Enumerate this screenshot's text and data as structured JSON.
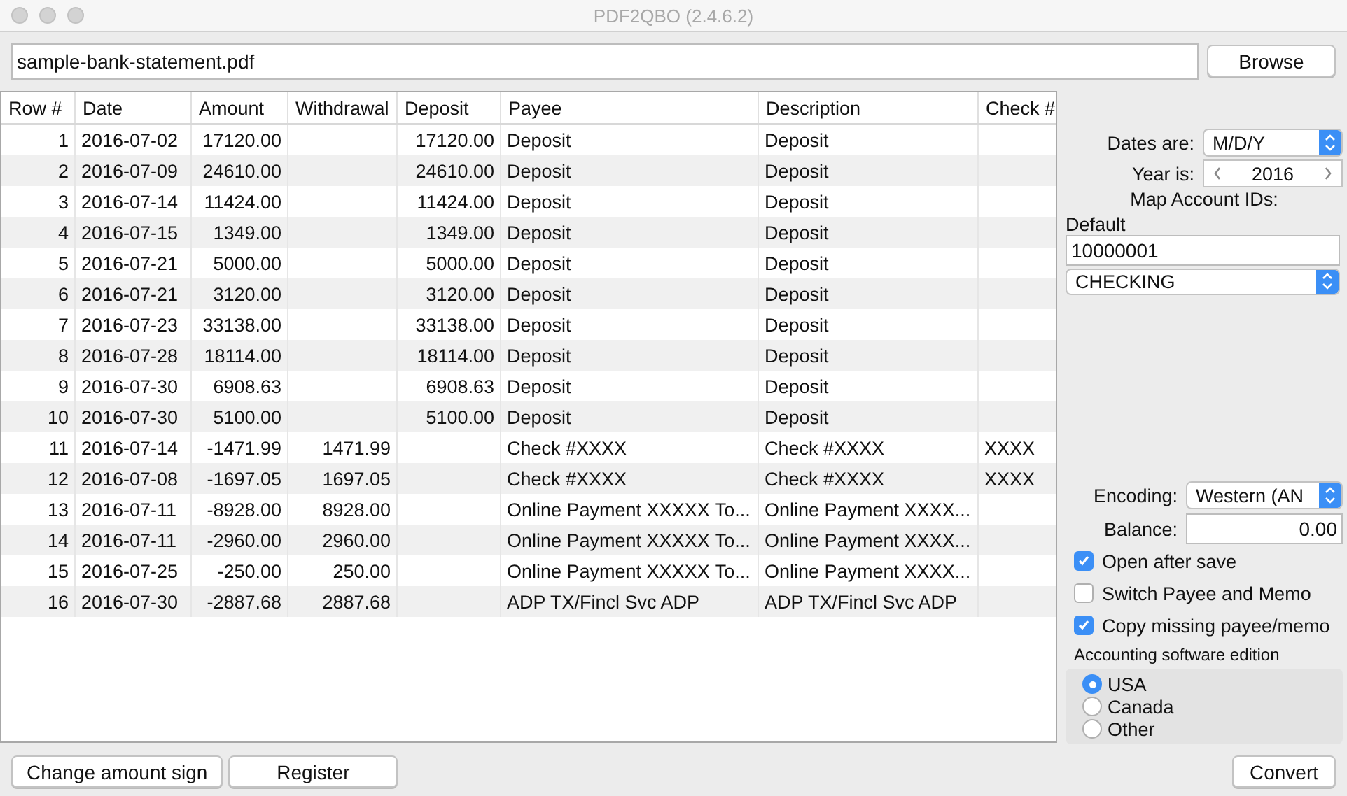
{
  "window": {
    "title": "PDF2QBO (2.4.6.2)"
  },
  "file_field": {
    "value": "sample-bank-statement.pdf"
  },
  "browse_button": "Browse",
  "table": {
    "columns": [
      "Row #",
      "Date",
      "Amount",
      "Withdrawal",
      "Deposit",
      "Payee",
      "Description",
      "Check #"
    ],
    "rows": [
      [
        "1",
        "2016-07-02",
        "17120.00",
        "",
        "17120.00",
        "Deposit",
        "Deposit",
        ""
      ],
      [
        "2",
        "2016-07-09",
        "24610.00",
        "",
        "24610.00",
        "Deposit",
        "Deposit",
        ""
      ],
      [
        "3",
        "2016-07-14",
        "11424.00",
        "",
        "11424.00",
        "Deposit",
        "Deposit",
        ""
      ],
      [
        "4",
        "2016-07-15",
        "1349.00",
        "",
        "1349.00",
        "Deposit",
        "Deposit",
        ""
      ],
      [
        "5",
        "2016-07-21",
        "5000.00",
        "",
        "5000.00",
        "Deposit",
        "Deposit",
        ""
      ],
      [
        "6",
        "2016-07-21",
        "3120.00",
        "",
        "3120.00",
        "Deposit",
        "Deposit",
        ""
      ],
      [
        "7",
        "2016-07-23",
        "33138.00",
        "",
        "33138.00",
        "Deposit",
        "Deposit",
        ""
      ],
      [
        "8",
        "2016-07-28",
        "18114.00",
        "",
        "18114.00",
        "Deposit",
        "Deposit",
        ""
      ],
      [
        "9",
        "2016-07-30",
        "6908.63",
        "",
        "6908.63",
        "Deposit",
        "Deposit",
        ""
      ],
      [
        "10",
        "2016-07-30",
        "5100.00",
        "",
        "5100.00",
        "Deposit",
        "Deposit",
        ""
      ],
      [
        "11",
        "2016-07-14",
        "-1471.99",
        "1471.99",
        "",
        "Check #XXXX",
        "Check #XXXX",
        "XXXX"
      ],
      [
        "12",
        "2016-07-08",
        "-1697.05",
        "1697.05",
        "",
        "Check #XXXX",
        "Check #XXXX",
        "XXXX"
      ],
      [
        "13",
        "2016-07-11",
        "-8928.00",
        "8928.00",
        "",
        "Online Payment XXXXX To...",
        "Online Payment XXXX...",
        ""
      ],
      [
        "14",
        "2016-07-11",
        "-2960.00",
        "2960.00",
        "",
        "Online Payment XXXXX To...",
        "Online Payment XXXX...",
        ""
      ],
      [
        "15",
        "2016-07-25",
        "-250.00",
        "250.00",
        "",
        "Online Payment XXXXX To...",
        "Online Payment XXXX...",
        ""
      ],
      [
        "16",
        "2016-07-30",
        "-2887.68",
        "2887.68",
        "",
        "ADP TX/Fincl Svc ADP",
        "ADP TX/Fincl Svc ADP",
        ""
      ]
    ]
  },
  "settings": {
    "dates_are": {
      "label": "Dates are:",
      "value": "M/D/Y"
    },
    "year": {
      "label": "Year is:",
      "value": "2016"
    },
    "map_label": "Map Account IDs:",
    "default_label": "Default",
    "account_id": "10000001",
    "account_type": "CHECKING",
    "encoding": {
      "label": "Encoding:",
      "value": "Western (AN"
    },
    "balance": {
      "label": "Balance:",
      "value": "0.00"
    },
    "checkboxes": [
      {
        "label": "Open after save",
        "checked": true
      },
      {
        "label": "Switch Payee and Memo",
        "checked": false
      },
      {
        "label": "Copy missing payee/memo",
        "checked": true
      }
    ],
    "edition": {
      "label": "Accounting software edition",
      "options": [
        {
          "label": "USA",
          "selected": true
        },
        {
          "label": "Canada",
          "selected": false
        },
        {
          "label": "Other",
          "selected": false
        }
      ]
    }
  },
  "bottom_buttons": {
    "change_sign": "Change amount sign",
    "register": "Register",
    "convert": "Convert"
  }
}
